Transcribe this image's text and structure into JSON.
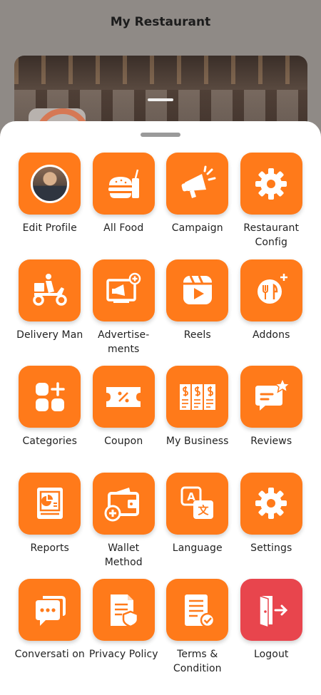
{
  "header": {
    "title": "My Restaurant"
  },
  "menu": {
    "items": [
      {
        "label": "Edit Profile",
        "icon": "profile-avatar-icon"
      },
      {
        "label": "All Food",
        "icon": "burger-drink-icon"
      },
      {
        "label": "Campaign",
        "icon": "megaphone-icon"
      },
      {
        "label": "Restaurant Config",
        "icon": "gear-icon"
      },
      {
        "label": "Delivery Man",
        "icon": "delivery-scooter-icon"
      },
      {
        "label": "Advertise-ments",
        "icon": "advertisement-icon"
      },
      {
        "label": "Reels",
        "icon": "reels-icon"
      },
      {
        "label": "Addons",
        "icon": "addons-icon"
      },
      {
        "label": "Categories",
        "icon": "categories-icon"
      },
      {
        "label": "Coupon",
        "icon": "coupon-icon"
      },
      {
        "label": "My Business",
        "icon": "business-plan-icon"
      },
      {
        "label": "Reviews",
        "icon": "reviews-icon"
      },
      {
        "label": "Reports",
        "icon": "reports-icon"
      },
      {
        "label": "Wallet Method",
        "icon": "wallet-icon"
      },
      {
        "label": "Language",
        "icon": "language-icon"
      },
      {
        "label": "Settings",
        "icon": "gear-icon"
      },
      {
        "label": "Conversati on",
        "icon": "conversation-icon"
      },
      {
        "label": "Privacy Policy",
        "icon": "privacy-policy-icon"
      },
      {
        "label": "Terms & Condition",
        "icon": "terms-icon"
      },
      {
        "label": "Logout",
        "icon": "logout-icon"
      }
    ]
  },
  "colors": {
    "tile": "#ff7a1a",
    "logout": "#e8454d",
    "sheet": "#ffffff"
  }
}
